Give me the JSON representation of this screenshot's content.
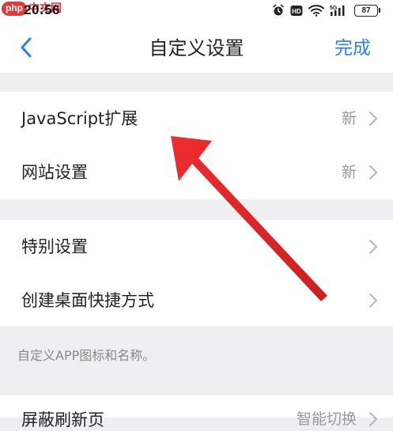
{
  "status_bar": {
    "watermark_badge": "php",
    "watermark_text": "中文网",
    "time": "20:56",
    "battery": "87",
    "icons": [
      "alarm-icon",
      "hd-icon",
      "wifi-icon",
      "signal-5g-icon",
      "battery-icon"
    ]
  },
  "nav": {
    "back_icon": "chevron-left-icon",
    "title": "自定义设置",
    "done_label": "完成",
    "accent_color": "#2a82e4"
  },
  "group1": [
    {
      "label": "JavaScript扩展",
      "value": "新"
    },
    {
      "label": "网站设置",
      "value": "新"
    }
  ],
  "group2": [
    {
      "label": "特别设置"
    },
    {
      "label": "创建桌面快捷方式"
    }
  ],
  "footer_note": "自定义APP图标和名称。",
  "group3": [
    {
      "label": "屏蔽刷新页",
      "value": "智能切换"
    }
  ],
  "annotation": {
    "type": "red-arrow",
    "points_to": "JavaScript扩展",
    "color": "#e0191b"
  }
}
